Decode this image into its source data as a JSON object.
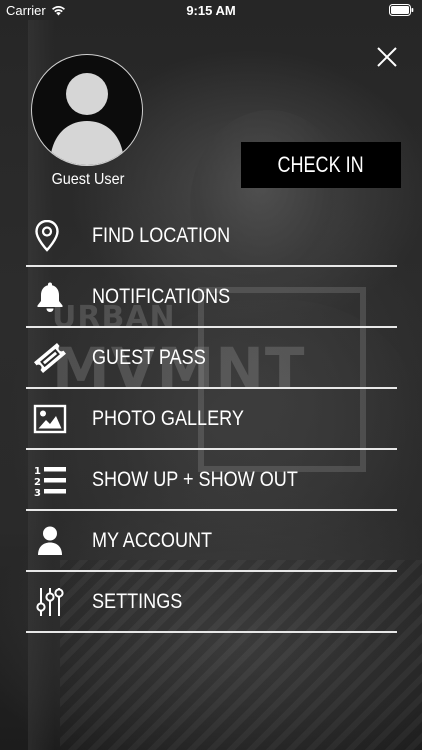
{
  "status_bar": {
    "carrier": "Carrier",
    "time": "9:15 AM"
  },
  "background": {
    "watermark_line1": "URBAN",
    "watermark_line2": "MVMNT"
  },
  "profile": {
    "user_name": "Guest User"
  },
  "check_in": {
    "label": "CHECK IN"
  },
  "menu": {
    "items": [
      {
        "label": "FIND LOCATION",
        "icon": "location-pin-icon"
      },
      {
        "label": "NOTIFICATIONS",
        "icon": "bell-icon"
      },
      {
        "label": "GUEST PASS",
        "icon": "ticket-icon"
      },
      {
        "label": "PHOTO GALLERY",
        "icon": "image-icon"
      },
      {
        "label": "SHOW UP + SHOW OUT",
        "icon": "numbered-list-icon"
      },
      {
        "label": "MY ACCOUNT",
        "icon": "person-icon"
      },
      {
        "label": "SETTINGS",
        "icon": "sliders-icon"
      }
    ]
  },
  "colors": {
    "text": "#ffffff",
    "button_background": "#000000",
    "divider": "#e8e8e8",
    "overlay": "#2a2a2a"
  }
}
